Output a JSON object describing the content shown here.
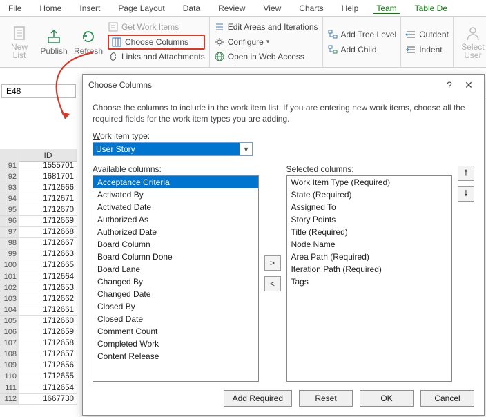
{
  "tabs": {
    "file": "File",
    "home": "Home",
    "insert": "Insert",
    "page_layout": "Page Layout",
    "data": "Data",
    "review": "Review",
    "view": "View",
    "charts": "Charts",
    "help": "Help",
    "team": "Team",
    "table_de": "Table De"
  },
  "ribbon": {
    "new_list": "New List",
    "publish": "Publish",
    "refresh": "Refresh",
    "get_work_items": "Get Work Items",
    "choose_columns": "Choose Columns",
    "links_attachments": "Links and Attachments",
    "edit_areas": "Edit Areas and Iterations",
    "configure": "Configure",
    "open_web": "Open in Web Access",
    "add_tree_level": "Add Tree Level",
    "add_child": "Add Child",
    "outdent": "Outdent",
    "indent": "Indent",
    "select_user": "Select User"
  },
  "namebox": "E48",
  "grid": {
    "col_header": "ID",
    "rows": [
      {
        "n": "91",
        "v": "1555701"
      },
      {
        "n": "92",
        "v": "1681701"
      },
      {
        "n": "93",
        "v": "1712666"
      },
      {
        "n": "94",
        "v": "1712671"
      },
      {
        "n": "95",
        "v": "1712670"
      },
      {
        "n": "96",
        "v": "1712669"
      },
      {
        "n": "97",
        "v": "1712668"
      },
      {
        "n": "98",
        "v": "1712667"
      },
      {
        "n": "99",
        "v": "1712663"
      },
      {
        "n": "100",
        "v": "1712665"
      },
      {
        "n": "101",
        "v": "1712664"
      },
      {
        "n": "102",
        "v": "1712653"
      },
      {
        "n": "103",
        "v": "1712662"
      },
      {
        "n": "104",
        "v": "1712661"
      },
      {
        "n": "105",
        "v": "1712660"
      },
      {
        "n": "106",
        "v": "1712659"
      },
      {
        "n": "107",
        "v": "1712658"
      },
      {
        "n": "108",
        "v": "1712657"
      },
      {
        "n": "109",
        "v": "1712656"
      },
      {
        "n": "110",
        "v": "1712655"
      },
      {
        "n": "111",
        "v": "1712654"
      },
      {
        "n": "112",
        "v": "1667730"
      }
    ]
  },
  "dialog": {
    "title": "Choose Columns",
    "help_char": "?",
    "close_char": "✕",
    "description": "Choose the columns to include in the work item list.  If you are entering new work items, choose all the required fields for the work item types you are adding.",
    "work_item_type_label": "Work item type:",
    "work_item_type_value": "User Story",
    "available_label": "Available columns:",
    "selected_label": "Selected columns:",
    "available": [
      "Acceptance Criteria",
      "Activated By",
      "Activated Date",
      "Authorized As",
      "Authorized Date",
      "Board Column",
      "Board Column Done",
      "Board Lane",
      "Changed By",
      "Changed Date",
      "Closed By",
      "Closed Date",
      "Comment Count",
      "Completed Work",
      "Content Release"
    ],
    "selected": [
      "Work Item Type (Required)",
      "State (Required)",
      "Assigned To",
      "Story Points",
      "Title (Required)",
      "Node Name",
      "Area Path (Required)",
      "Iteration Path (Required)",
      "Tags"
    ],
    "move_right": ">",
    "move_left": "<",
    "move_up": "🠕",
    "move_down": "🠗",
    "btn_add_required": "Add Required",
    "btn_reset": "Reset",
    "btn_ok": "OK",
    "btn_cancel": "Cancel"
  }
}
